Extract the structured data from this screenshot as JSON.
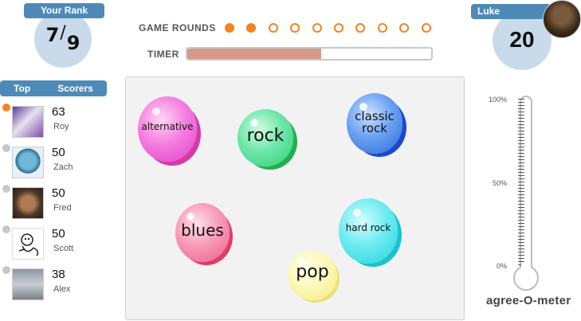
{
  "rank": {
    "label": "Your Rank",
    "position": "7",
    "total": "9",
    "separator": "/"
  },
  "rounds": {
    "label": "GAME ROUNDS",
    "total": 10,
    "completed": 2,
    "accent_color": "#f58220"
  },
  "timer": {
    "label": "TIMER",
    "progress": 0.55,
    "fill_color": "#d69988"
  },
  "player": {
    "name": "Luke",
    "score": "20"
  },
  "top_scorers": {
    "label_left": "Top",
    "label_right": "Scorers",
    "entries": [
      {
        "score": "63",
        "name": "Roy",
        "leader": true
      },
      {
        "score": "50",
        "name": "Zach",
        "leader": false
      },
      {
        "score": "50",
        "name": "Fred",
        "leader": false
      },
      {
        "score": "50",
        "name": "Scott",
        "leader": false
      },
      {
        "score": "38",
        "name": "Alex",
        "leader": false
      }
    ]
  },
  "bubbles": [
    {
      "label": "alternative",
      "color": "pink"
    },
    {
      "label": "rock",
      "color": "green"
    },
    {
      "label": "classic rock",
      "color": "blue"
    },
    {
      "label": "blues",
      "color": "rose"
    },
    {
      "label": "hard rock",
      "color": "cyan"
    },
    {
      "label": "pop",
      "color": "yellow"
    }
  ],
  "meter": {
    "name": "agree-O-meter",
    "ticks": [
      "100%",
      "50%",
      "0%"
    ],
    "level": 0
  },
  "colors": {
    "panel_tab": "#4e8ab8",
    "circle_bg": "#c9dbea"
  }
}
